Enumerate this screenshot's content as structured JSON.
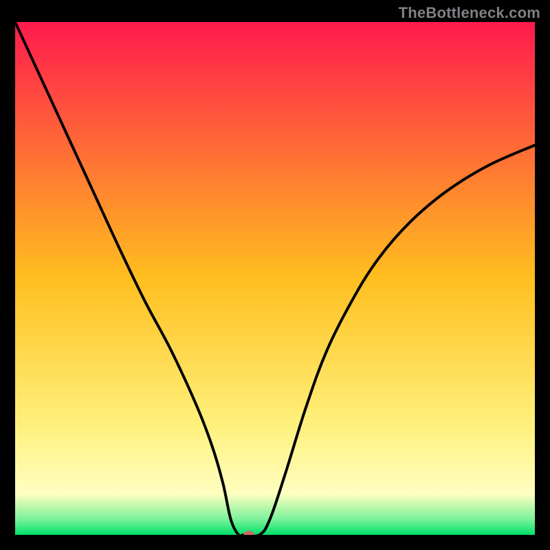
{
  "watermark": {
    "text": "TheBottleneck.com"
  },
  "chart_data": {
    "type": "line",
    "title": "",
    "xlabel": "",
    "ylabel": "",
    "xlim": [
      0,
      100
    ],
    "ylim": [
      0,
      100
    ],
    "grid": false,
    "legend": false,
    "background_gradient": [
      {
        "pos": 0.0,
        "color": "#ff1a4d"
      },
      {
        "pos": 0.5,
        "color": "#ffbf1f"
      },
      {
        "pos": 0.78,
        "color": "#fff07a"
      },
      {
        "pos": 0.92,
        "color": "#ffffc0"
      },
      {
        "pos": 0.97,
        "color": "#7af29a"
      },
      {
        "pos": 1.0,
        "color": "#00e06a"
      }
    ],
    "series": [
      {
        "name": "bottleneck-curve",
        "x": [
          0,
          5,
          10,
          15,
          20,
          25,
          30,
          35,
          38,
          40,
          41.5,
          43,
          44,
          47,
          49,
          52,
          56,
          60,
          65,
          70,
          76,
          83,
          91,
          100
        ],
        "y": [
          100,
          89,
          78,
          67,
          56,
          45.5,
          36,
          25,
          17,
          10,
          3,
          0,
          0,
          0,
          3,
          12,
          25,
          36,
          46,
          54,
          61,
          67,
          72,
          76
        ]
      }
    ],
    "marker": {
      "x": 45,
      "y": 0,
      "color": "#c86c62",
      "rx": 8,
      "ry": 6
    }
  }
}
